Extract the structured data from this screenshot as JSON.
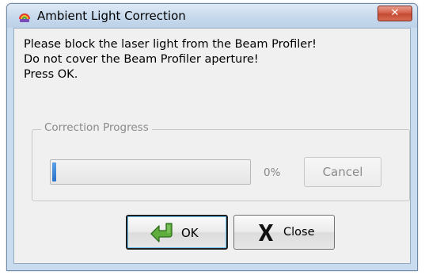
{
  "window": {
    "title": "Ambient Light Correction",
    "close_label": "✕"
  },
  "message": {
    "line1": "Please block the laser light from the Beam Profiler!",
    "line2": "Do not cover the Beam Profiler aperture!",
    "line3": "Press OK."
  },
  "progress_group": {
    "label": "Correction Progress",
    "progress_fraction": 0.02,
    "percent_text": "0%",
    "cancel_label": "Cancel",
    "cancel_enabled": false
  },
  "buttons": {
    "ok_label": "OK",
    "close_label": "Close"
  },
  "icons": {
    "app": "rainbow-app-icon",
    "ok": "green-arrow-icon",
    "close": "x-icon"
  },
  "colors": {
    "progress_fill": "#2a72c8",
    "ok_arrow": "#4a9a2e",
    "close_button_red": "#c44a33"
  }
}
